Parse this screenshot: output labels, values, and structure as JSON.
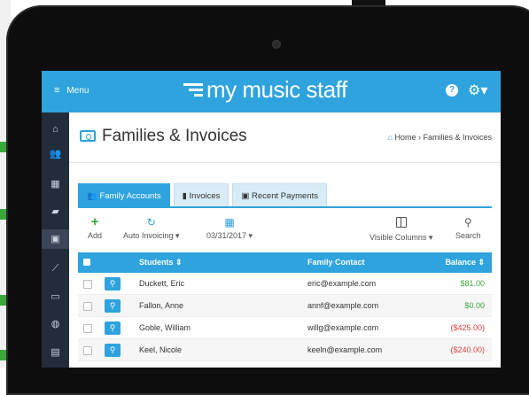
{
  "app": {
    "menu_label": "Menu",
    "logo_text": "my music staff",
    "help_icon": "question-circle-icon",
    "settings_icon": "gear-icon"
  },
  "sidebar": {
    "items": [
      {
        "icon": "home-icon"
      },
      {
        "icon": "users-icon"
      },
      {
        "icon": "calendar-icon"
      },
      {
        "icon": "book-icon"
      },
      {
        "icon": "money-icon"
      },
      {
        "icon": "chart-icon"
      },
      {
        "icon": "car-icon"
      },
      {
        "icon": "globe-icon"
      },
      {
        "icon": "id-card-icon"
      }
    ]
  },
  "page": {
    "title": "Families & Invoices",
    "breadcrumb": "Home › Families & Invoices"
  },
  "tabs": [
    {
      "label": "Family Accounts",
      "active": true
    },
    {
      "label": "Invoices",
      "active": false
    },
    {
      "label": "Recent Payments",
      "active": false
    }
  ],
  "toolbar": {
    "add": "Add",
    "auto_invoicing": "Auto Invoicing ▾",
    "date": "03/31/2017 ▾",
    "visible_columns": "Visible Columns ▾",
    "search": "Search"
  },
  "table": {
    "headers": {
      "students": "Students ⇕",
      "family_contact": "Family Contact",
      "balance": "Balance ⇕"
    },
    "rows": [
      {
        "student": "Duckett, Eric",
        "contact": "eric@example.com",
        "balance": "$81.00",
        "status": "positive"
      },
      {
        "student": "Fallon, Anne",
        "contact": "annf@example.com",
        "balance": "$0.00",
        "status": "positive"
      },
      {
        "student": "Goble, William",
        "contact": "willg@example.com",
        "balance": "($425.00)",
        "status": "negative"
      },
      {
        "student": "Keel, Nicole",
        "contact": "keeln@example.com",
        "balance": "($240.00)",
        "status": "negative"
      }
    ]
  },
  "colors": {
    "accent": "#2ea3dd",
    "sidebar": "#222c3a",
    "positive": "#3aa83a",
    "negative": "#e04040"
  }
}
